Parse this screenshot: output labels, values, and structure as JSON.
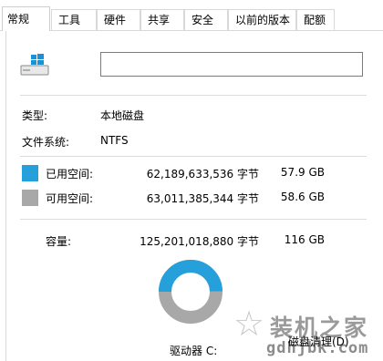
{
  "tabs": [
    {
      "label": "常规",
      "active": true
    },
    {
      "label": "工具",
      "active": false
    },
    {
      "label": "硬件",
      "active": false
    },
    {
      "label": "共享",
      "active": false
    },
    {
      "label": "安全",
      "active": false
    },
    {
      "label": "以前的版本",
      "active": false
    },
    {
      "label": "配额",
      "active": false
    }
  ],
  "drive": {
    "icon": "windows-drive-icon",
    "name_value": ""
  },
  "info": {
    "type_label": "类型:",
    "type_value": "本地磁盘",
    "fs_label": "文件系统:",
    "fs_value": "NTFS"
  },
  "space": {
    "used": {
      "label": "已用空间:",
      "bytes": "62,189,633,536 字节",
      "size": "57.9 GB",
      "color": "#26a0da"
    },
    "free": {
      "label": "可用空间:",
      "bytes": "63,011,385,344 字节",
      "size": "58.6 GB",
      "color": "#a8a8a8"
    },
    "capacity": {
      "label": "容量:",
      "bytes": "125,201,018,880 字节",
      "size": "116 GB"
    }
  },
  "usage_chart": {
    "used_fraction": 0.4967,
    "used_color": "#26a0da",
    "free_color": "#a8a8a8"
  },
  "drive_label": "驱动器 C:",
  "cleanup_button": "磁盘清理(D)",
  "watermark": {
    "title": "装机之家",
    "url": "gdhjbk.com"
  },
  "colors": {
    "border": "#d9d9d9"
  }
}
